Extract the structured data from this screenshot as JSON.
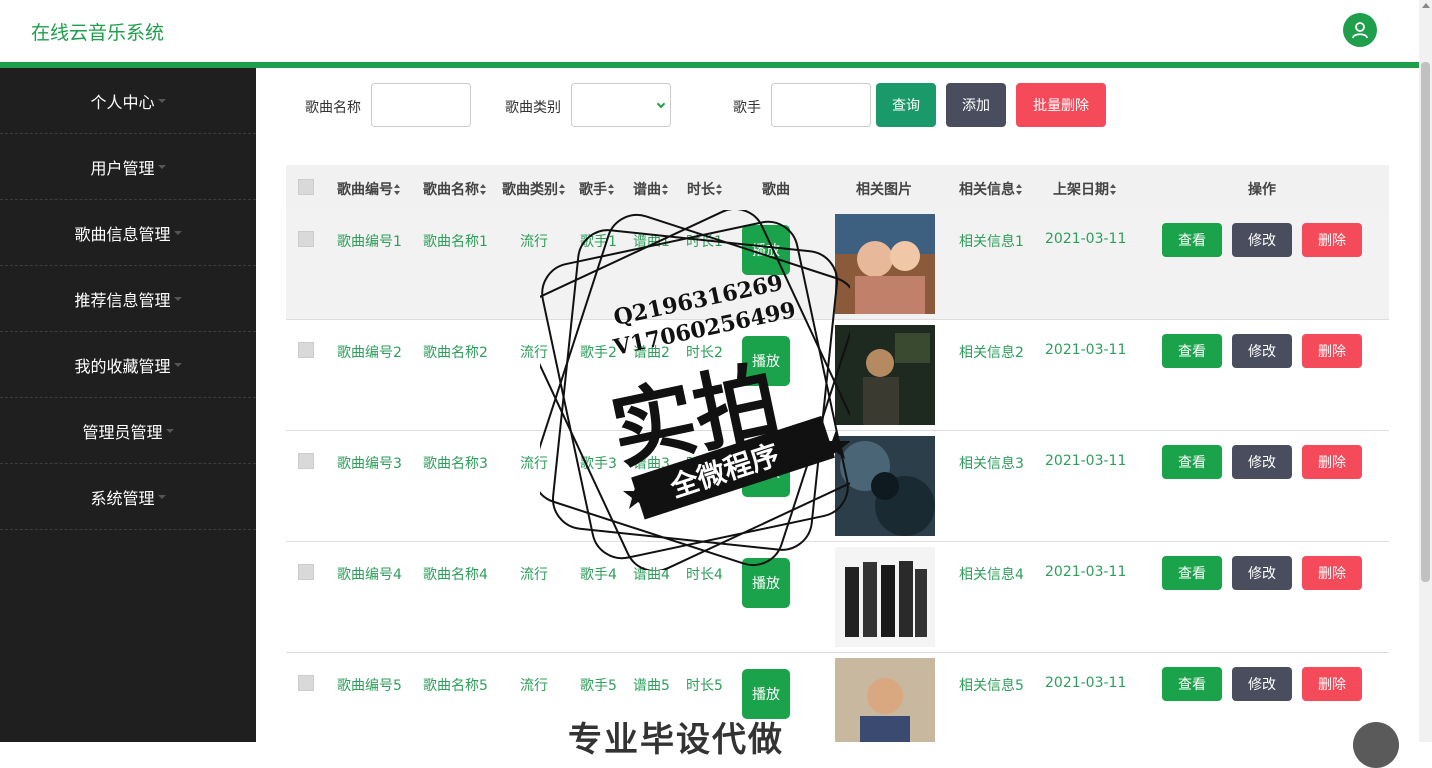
{
  "app": {
    "title": "在线云音乐系统"
  },
  "colors": {
    "primary": "#1f9e4b",
    "sidebar": "#1f1f1f",
    "edit": "#4a4d5e",
    "danger": "#f44a5a"
  },
  "sidebar": {
    "items": [
      {
        "label": "个人中心"
      },
      {
        "label": "用户管理"
      },
      {
        "label": "歌曲信息管理"
      },
      {
        "label": "推荐信息管理"
      },
      {
        "label": "我的收藏管理"
      },
      {
        "label": "管理员管理"
      },
      {
        "label": "系统管理"
      }
    ]
  },
  "filter": {
    "song_name_label": "歌曲名称",
    "song_type_label": "歌曲类别",
    "singer_label": "歌手",
    "query_label": "查询",
    "add_label": "添加",
    "batch_delete_label": "批量删除"
  },
  "table": {
    "headers": {
      "id": "歌曲编号",
      "name": "歌曲名称",
      "type": "歌曲类别",
      "singer": "歌手",
      "score": "谱曲",
      "duration": "时长",
      "song": "歌曲",
      "picture": "相关图片",
      "info": "相关信息",
      "date": "上架日期",
      "ops": "操作"
    },
    "rows": [
      {
        "id": "歌曲编号1",
        "name": "歌曲名称1",
        "type": "流行",
        "singer": "歌手1",
        "score": "谱曲1",
        "duration": "时长1",
        "info": "相关信息1",
        "date": "2021-03-11"
      },
      {
        "id": "歌曲编号2",
        "name": "歌曲名称2",
        "type": "流行",
        "singer": "歌手2",
        "score": "谱曲2",
        "duration": "时长2",
        "info": "相关信息2",
        "date": "2021-03-11"
      },
      {
        "id": "歌曲编号3",
        "name": "歌曲名称3",
        "type": "流行",
        "singer": "歌手3",
        "score": "谱曲3",
        "duration": "时长3",
        "info": "相关信息3",
        "date": "2021-03-11"
      },
      {
        "id": "歌曲编号4",
        "name": "歌曲名称4",
        "type": "流行",
        "singer": "歌手4",
        "score": "谱曲4",
        "duration": "时长4",
        "info": "相关信息4",
        "date": "2021-03-11"
      },
      {
        "id": "歌曲编号5",
        "name": "歌曲名称5",
        "type": "流行",
        "singer": "歌手5",
        "score": "谱曲5",
        "duration": "时长5",
        "info": "相关信息5",
        "date": "2021-03-11"
      }
    ],
    "play_label": "播放",
    "view_label": "查看",
    "edit_label": "修改",
    "delete_label": "删除"
  },
  "watermark": {
    "line1": "Q2196316269",
    "line2": "V17060256499",
    "big": "实拍",
    "banner": "全微程序",
    "bottom": "专业毕设代做"
  }
}
